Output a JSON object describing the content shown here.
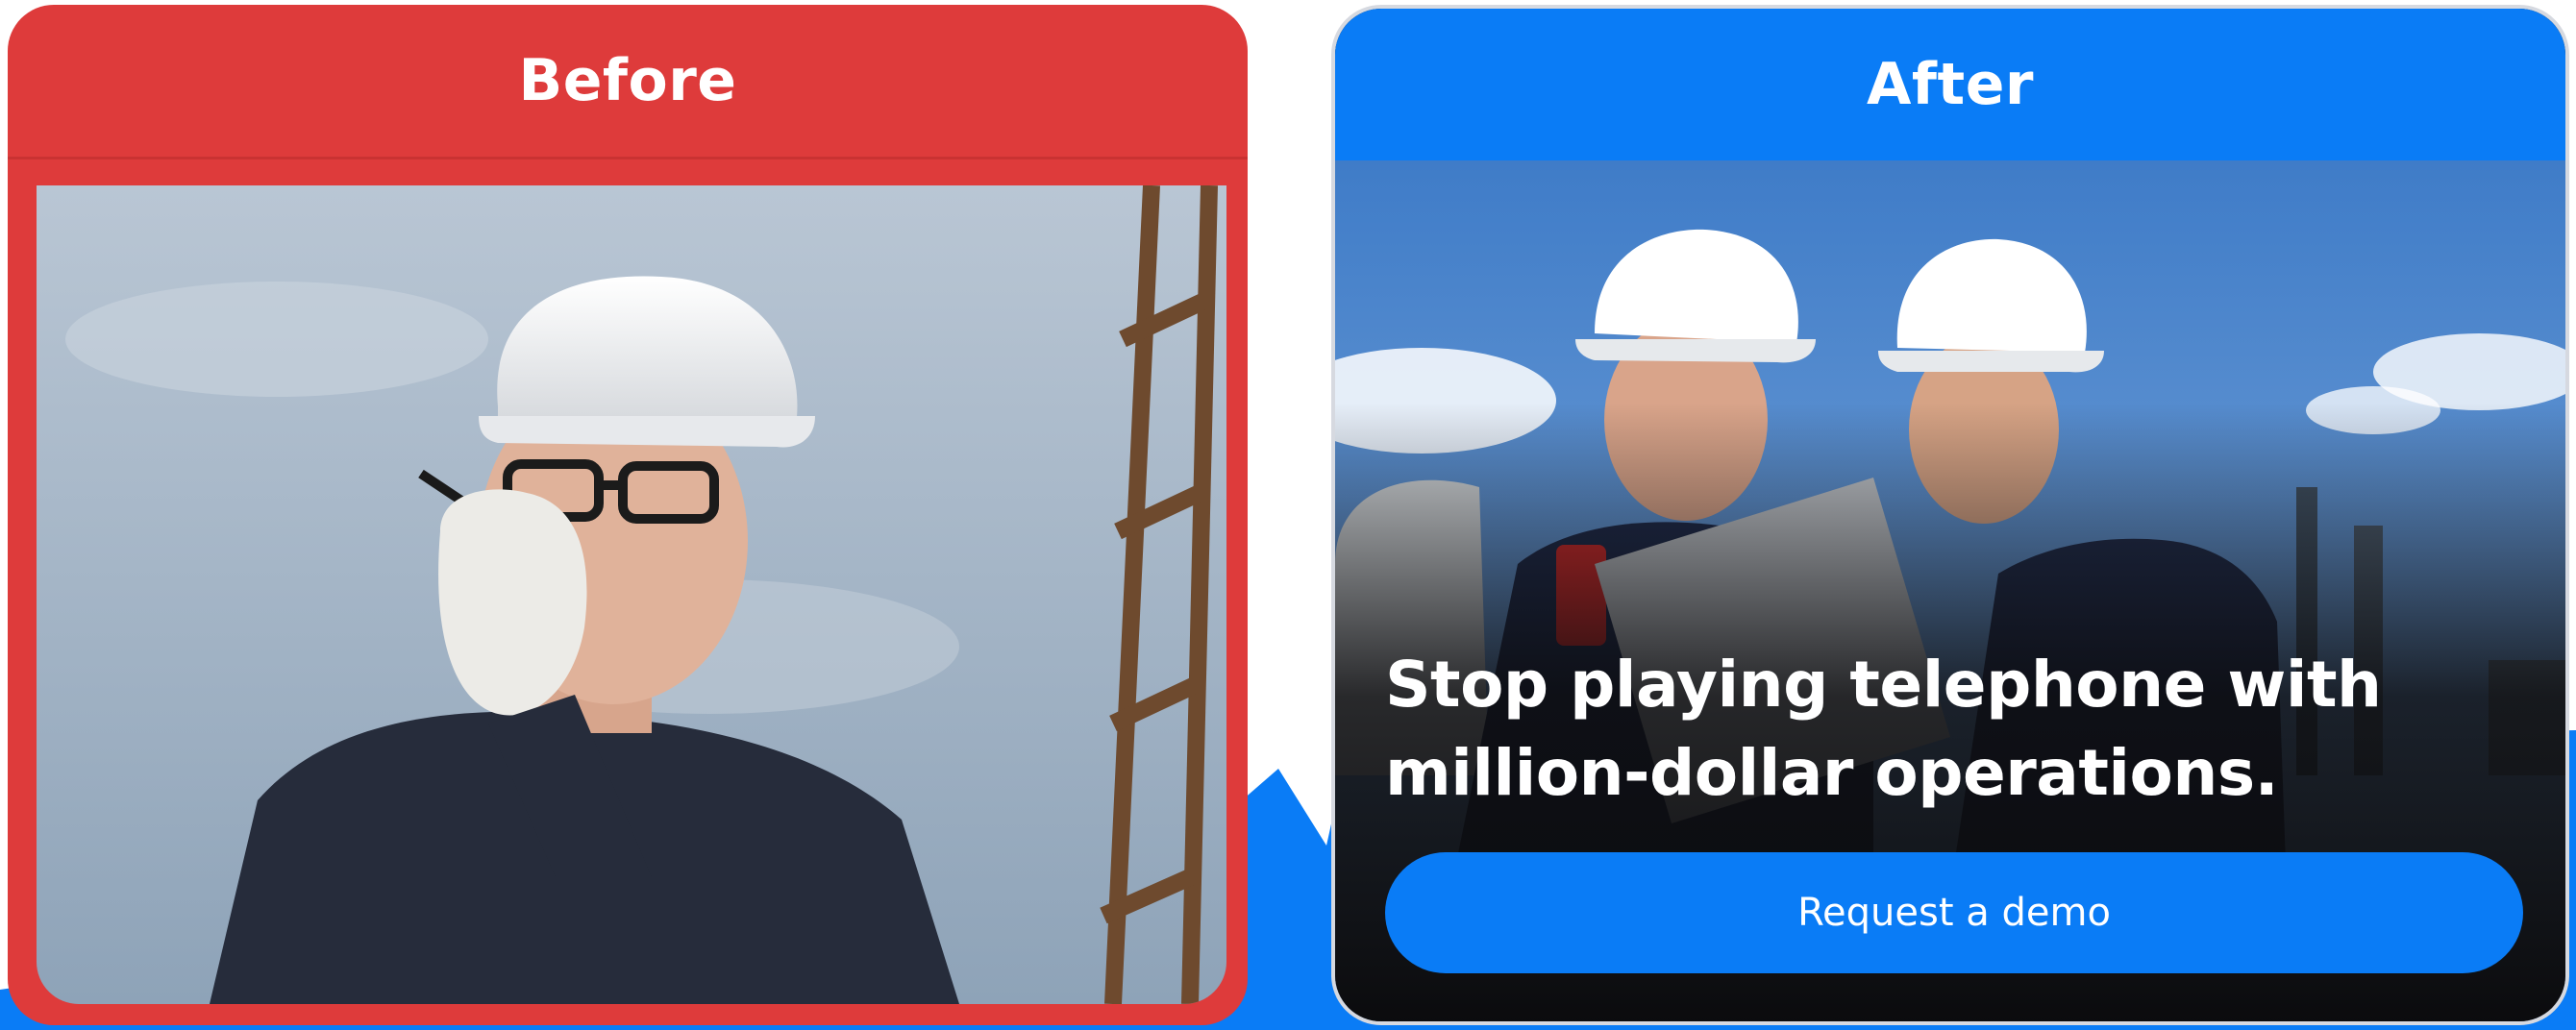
{
  "before_card": {
    "title": "Before",
    "photo_alt": ""
  },
  "after_card": {
    "title": "After",
    "headline_line1": "Stop playing telephone with",
    "headline_line2": "million-dollar operations.",
    "cta_label": "Request a demo"
  },
  "colors": {
    "before_accent": "#DE3B3B",
    "after_accent": "#0A7CF6",
    "background_shape": "#0A7CF6",
    "after_overlay": "#0b0b0d"
  }
}
